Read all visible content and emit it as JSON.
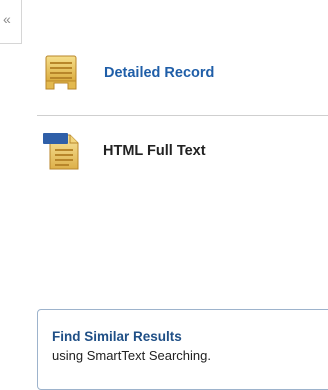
{
  "sidebar": {
    "collapse_label": "«",
    "collapse_icon": "double-chevron-left-icon"
  },
  "record_links": {
    "detailed": {
      "label": "Detailed Record",
      "icon": "detailed-record-icon"
    },
    "fulltext": {
      "label": "HTML Full Text",
      "icon": "html-full-text-icon",
      "badge": "HTML"
    }
  },
  "find_similar": {
    "title": "Find Similar Results",
    "subtitle": "using SmartText Searching."
  },
  "colors": {
    "link_blue": "#1f5ea8",
    "title_blue": "#1f4f86",
    "icon_gold": "#e7c35a",
    "icon_badge": "#2f5fa8"
  }
}
